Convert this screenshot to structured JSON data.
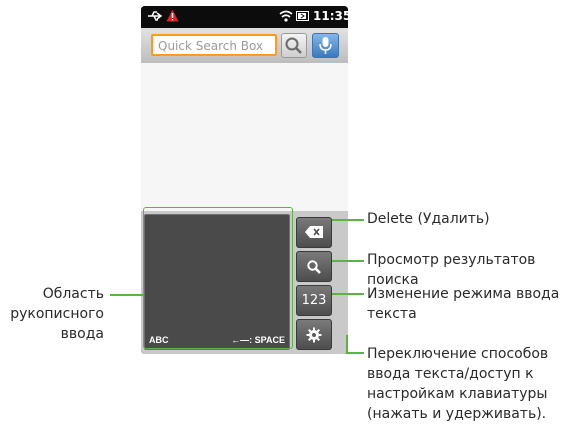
{
  "status_bar": {
    "usb_icon": "usb-icon",
    "warning_icon": "warning-icon",
    "wifi_icon": "wifi-icon",
    "battery_icon": "battery-icon",
    "time": "11:35"
  },
  "search": {
    "placeholder": "Quick Search Box",
    "search_icon": "magnifier-icon",
    "voice_icon": "microphone-icon"
  },
  "keyboard": {
    "handwriting_abc": "ABC",
    "handwriting_space": "←—: SPACE",
    "key_delete_icon": "backspace-icon",
    "key_search_icon": "magnifier-icon",
    "key_mode": "123",
    "key_settings_icon": "gear-icon"
  },
  "callouts": {
    "handwriting_area": "Область рукописного ввода",
    "handwriting_line1": "Область",
    "handwriting_line2": "рукописного",
    "handwriting_line3": "ввода",
    "delete": "Delete (Удалить)",
    "search_results": "Просмотр результатов поиска",
    "mode_line1": "Изменение режима ввода",
    "mode_line2": "текста",
    "settings_line1": "Переключение способов",
    "settings_line2": "ввода текста/доступ к",
    "settings_line3": "настройкам клавиатуры",
    "settings_line4": "(нажать и удерживать)."
  },
  "colors": {
    "callout": "#5cb343",
    "focus": "#ff9a1a",
    "voice": "#3a79c0"
  }
}
